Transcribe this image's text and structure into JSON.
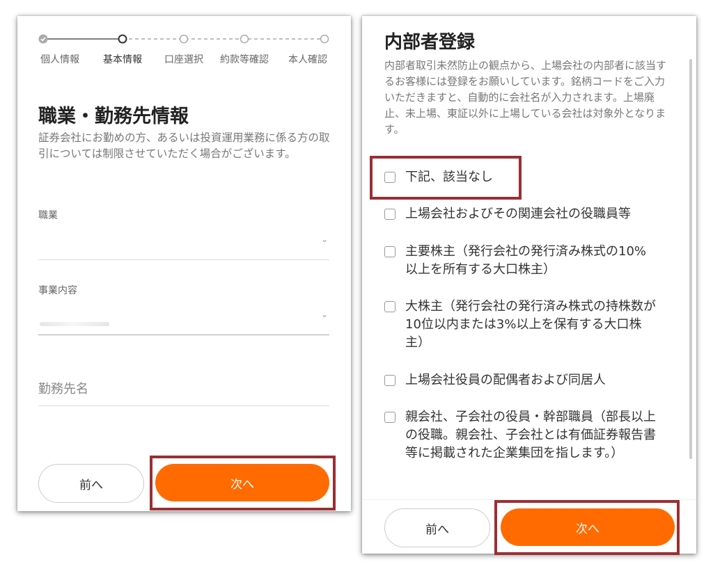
{
  "left": {
    "stepper": {
      "steps": [
        "個人情報",
        "基本情報",
        "口座選択",
        "約款等確認",
        "本人確認"
      ],
      "active_index": 1
    },
    "title": "職業・勤務先情報",
    "description": "証券会社にお勤めの方、あるいは投資運用業務に係る方の取引については制限させていただく場合がございます。",
    "fields": {
      "occupation_label": "職業",
      "business_label": "事業内容",
      "employer_placeholder": "勤務先名"
    },
    "buttons": {
      "prev": "前へ",
      "next": "次へ"
    }
  },
  "right": {
    "title": "内部者登録",
    "description": "内部者取引未然防止の観点から、上場会社の内部者に該当するお客様には登録をお願いしています。銘柄コードをご入力いただきますと、自動的に会社名が入力されます。上場廃止、未上場、東証以外に上場している会社は対象外となります。",
    "options": [
      "下記、該当なし",
      "上場会社およびその関連会社の役職員等",
      "主要株主（発行会社の発行済み株式の10%以上を所有する大口株主）",
      "大株主（発行会社の発行済み株式の持株数が10位以内または3%以上を保有する大口株主）",
      "上場会社役員の配偶者および同居人",
      "親会社、子会社の役員・幹部職員（部長以上の役職。親会社、子会社とは有価証券報告書等に掲載された企業集団を指します。）"
    ],
    "buttons": {
      "prev": "前へ",
      "next": "次へ"
    }
  },
  "colors": {
    "accent": "#ff6b00",
    "highlight": "#9a2f33"
  }
}
